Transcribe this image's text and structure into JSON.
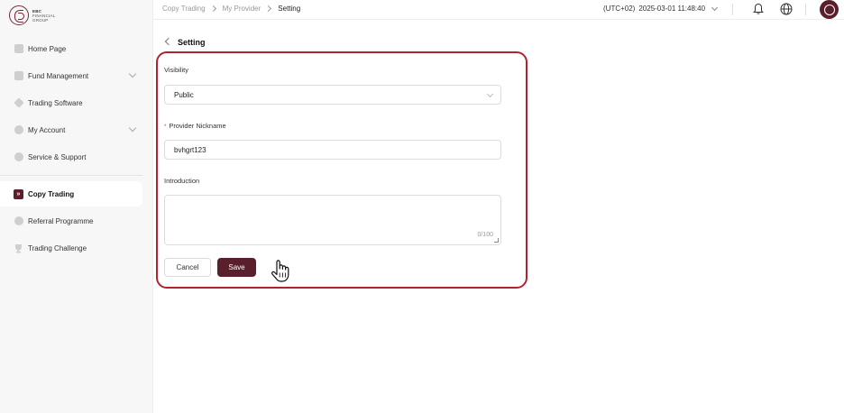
{
  "brand": {
    "line1": "EBC",
    "line2": "FINANCIAL",
    "line3": "GROUP"
  },
  "sidebar": {
    "items": [
      {
        "label": "Home Page",
        "icon": "home-icon"
      },
      {
        "label": "Fund Management",
        "icon": "fund-icon",
        "expandable": true
      },
      {
        "label": "Trading Software",
        "icon": "cube-icon"
      },
      {
        "label": "My Account",
        "icon": "user-icon",
        "expandable": true
      },
      {
        "label": "Service & Support",
        "icon": "help-icon"
      },
      {
        "label": "Copy Trading",
        "icon": "copy-trading-icon",
        "active": true
      },
      {
        "label": "Referral Programme",
        "icon": "referral-icon"
      },
      {
        "label": "Trading Challenge",
        "icon": "trophy-icon"
      }
    ]
  },
  "header": {
    "breadcrumb": [
      "Copy Trading",
      "My Provider",
      "Setting"
    ],
    "timezone": "(UTC+02)",
    "datetime": "2025-03-01 11:48:40"
  },
  "page": {
    "title": "Setting",
    "visibility": {
      "label": "Visibility",
      "value": "Public"
    },
    "nickname": {
      "label": "Provider Nickname",
      "required_mark": "*",
      "value": "bvhgrt123"
    },
    "introduction": {
      "label": "Introduction",
      "value": "",
      "counter": "0/100"
    },
    "cancel_label": "Cancel",
    "save_label": "Save"
  },
  "colors": {
    "accent": "#5a1f2a",
    "highlight": "#b0232e"
  }
}
